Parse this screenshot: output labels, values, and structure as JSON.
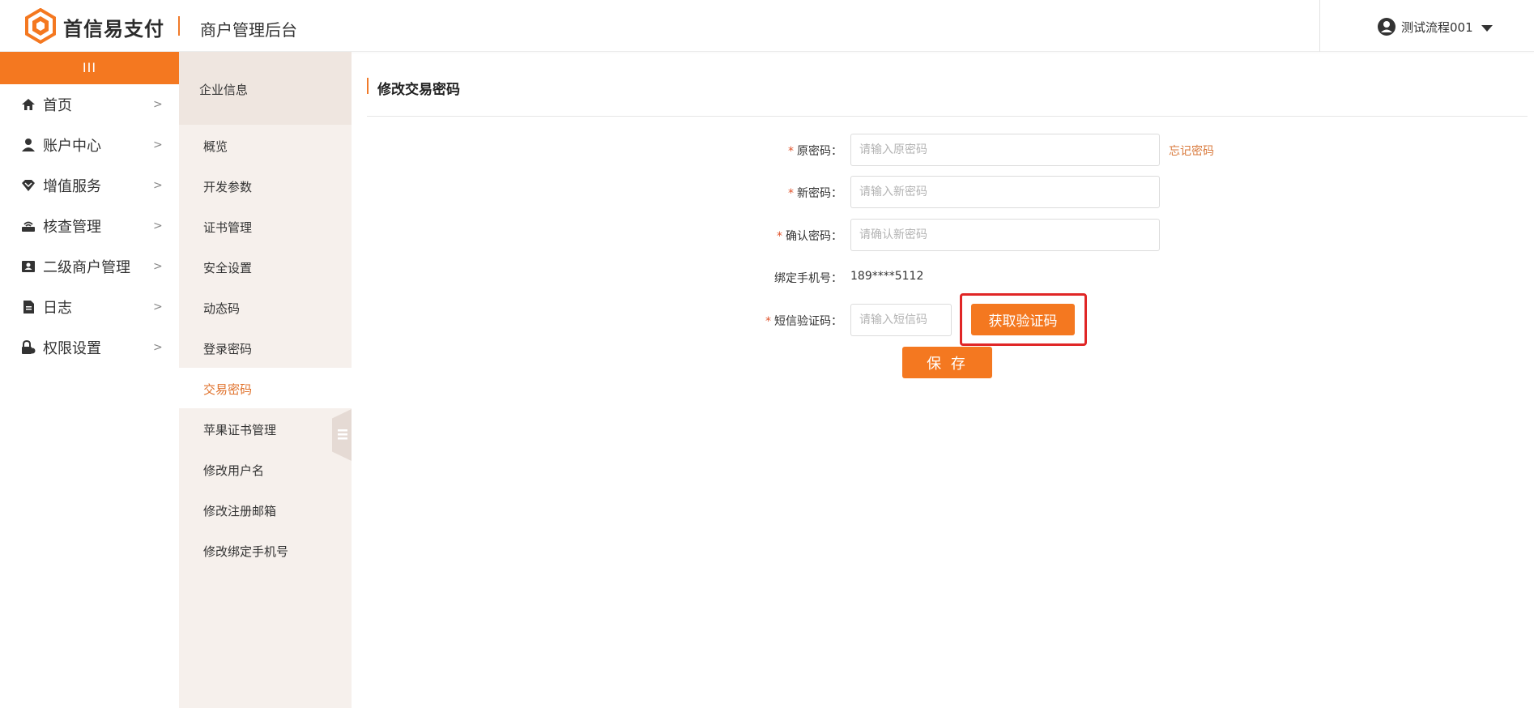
{
  "header": {
    "brand": "首信易支付",
    "subtitle": "商户管理后台",
    "user_name": "测试流程001"
  },
  "sidebar": {
    "collapse_label": "III",
    "items": [
      {
        "label": "首页",
        "icon": "home-icon"
      },
      {
        "label": "账户中心",
        "icon": "user-icon"
      },
      {
        "label": "增值服务",
        "icon": "diamond-icon"
      },
      {
        "label": "核查管理",
        "icon": "router-icon"
      },
      {
        "label": "二级商户管理",
        "icon": "id-card-icon"
      },
      {
        "label": "日志",
        "icon": "document-icon"
      },
      {
        "label": "权限设置",
        "icon": "lock-icon"
      }
    ],
    "chevron": ">"
  },
  "subnav": {
    "header": "企业信息",
    "items": [
      "概览",
      "开发参数",
      "证书管理",
      "安全设置",
      "动态码",
      "登录密码",
      "交易密码",
      "苹果证书管理",
      "修改用户名",
      "修改注册邮箱",
      "修改绑定手机号"
    ],
    "active_index": 6
  },
  "main": {
    "title": "修改交易密码",
    "form": {
      "required_mark": "*",
      "old_password_label": "原密码：",
      "old_password_placeholder": "请输入原密码",
      "forgot_link": "忘记密码",
      "new_password_label": "新密码：",
      "new_password_placeholder": "请输入新密码",
      "confirm_password_label": "确认密码：",
      "confirm_password_placeholder": "请确认新密码",
      "phone_label": "绑定手机号：",
      "phone_value": "189****5112",
      "sms_label": "短信验证码：",
      "sms_placeholder": "请输入短信码",
      "get_code_button": "获取验证码",
      "save_button": "保 存"
    }
  },
  "colors": {
    "accent": "#f47820",
    "highlight": "#e02626",
    "subnav_bg": "#f6f0ec"
  }
}
